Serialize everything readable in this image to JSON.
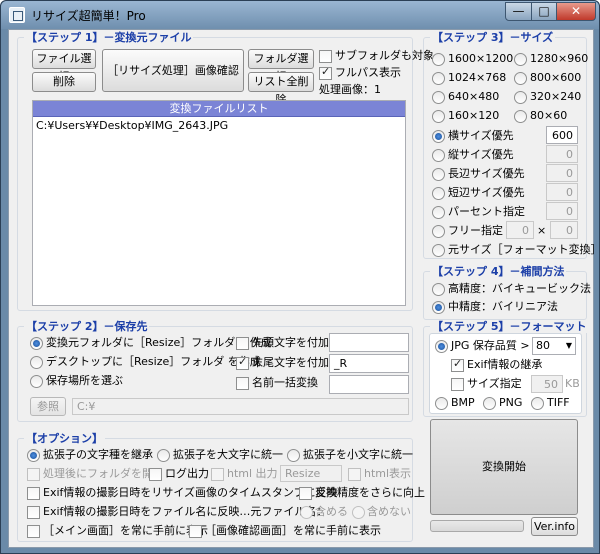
{
  "window": {
    "title": "リサイズ超簡単！Pro",
    "min_glyph": "—",
    "max_glyph": "□",
    "close_glyph": "✕"
  },
  "step1": {
    "title": "【ステップ 1】－変換元ファイル",
    "file_select": "ファイル選択",
    "delete": "削除",
    "preview": "［リサイズ処理］画像確認",
    "folder_select": "フォルダ選択",
    "delete_all": "リスト全削除",
    "subfolder_label": "サブフォルダも対象",
    "subfolder_checked": false,
    "fullpath_label": "フルパス表示",
    "fullpath_checked": true,
    "processed_label": "処理画像：",
    "processed_count": "1",
    "list_header": "変換ファイルリスト",
    "files": [
      "C:¥Users¥¥Desktop¥IMG_2643.JPG"
    ]
  },
  "step2": {
    "title": "【ステップ 2】－保存先",
    "options": [
      "変換元フォルダに［Resize］フォルダ を作成",
      "デスクトップに［Resize］フォルダ を作成",
      "保存場所を選ぶ"
    ],
    "selected": 0,
    "prefix_label": "先頭文字を付加",
    "prefix_checked": false,
    "prefix_value": "",
    "suffix_label": "末尾文字を付加",
    "suffix_checked": true,
    "suffix_value": "_R",
    "rename_label": "名前一括変換",
    "rename_checked": false,
    "rename_value": "",
    "browse_label": "参照",
    "path_value": "C:¥"
  },
  "step3": {
    "title": "【ステップ 3】－サイズ",
    "sizes": [
      "1600×1200",
      "1280×960",
      "1024×768",
      "800×600",
      "640×480",
      "320×240",
      "160×120",
      "80×60"
    ],
    "options": [
      {
        "label": "横サイズ優先",
        "value": "600",
        "selected": true
      },
      {
        "label": "縦サイズ優先",
        "value": "0",
        "selected": false
      },
      {
        "label": "長辺サイズ優先",
        "value": "0",
        "selected": false
      },
      {
        "label": "短辺サイズ優先",
        "value": "0",
        "selected": false
      },
      {
        "label": "パーセント指定",
        "value": "0",
        "selected": false
      }
    ],
    "free_label": "フリー指定",
    "free_w": "0",
    "free_x": "×",
    "free_h": "0",
    "original_label": "元サイズ［フォーマット変換］"
  },
  "step4": {
    "title": "【ステップ 4】－補間方法",
    "options": [
      "高精度：バイキュービック法",
      "中精度：バイリニア法"
    ],
    "selected": 1
  },
  "step5": {
    "title": "【ステップ 5】－フォーマット",
    "jpg_label": "JPG 保存品質 >",
    "quality": "80",
    "exif_label": "Exif情報の継承",
    "exif_checked": true,
    "size_label": "サイズ指定",
    "size_checked": false,
    "size_value": "50",
    "size_unit": "KB",
    "formats": [
      "BMP",
      "PNG",
      "TIFF"
    ],
    "format_selected": "JPG"
  },
  "convert_button": "変換開始",
  "version_button": "Ver.info",
  "progress": 0.0,
  "options": {
    "title": "【オプション】",
    "radio_labels": [
      "拡張子の文字種を継承",
      "拡張子を大文字に統一",
      "拡張子を小文字に統一"
    ],
    "radio_selected": 0,
    "open_folder_label": "処理後にフォルダを開く",
    "log_label": "ログ出力",
    "html_label": "html 出力",
    "html_value": "Resize",
    "html_show_label": "html表示",
    "timestamp_label": "Exif情報の撮影日時をリサイズ画像のタイムスタンプに反映",
    "accuracy_label": "変換精度をさらに向上",
    "filename_label": "Exif情報の撮影日時をファイル名に反映…元ファイル名：",
    "include_label": "含める",
    "exclude_label": "含めない",
    "main_top_label": "［メイン画面］を常に手前に表示",
    "preview_top_label": "［画像確認画面］を常に手前に表示"
  }
}
